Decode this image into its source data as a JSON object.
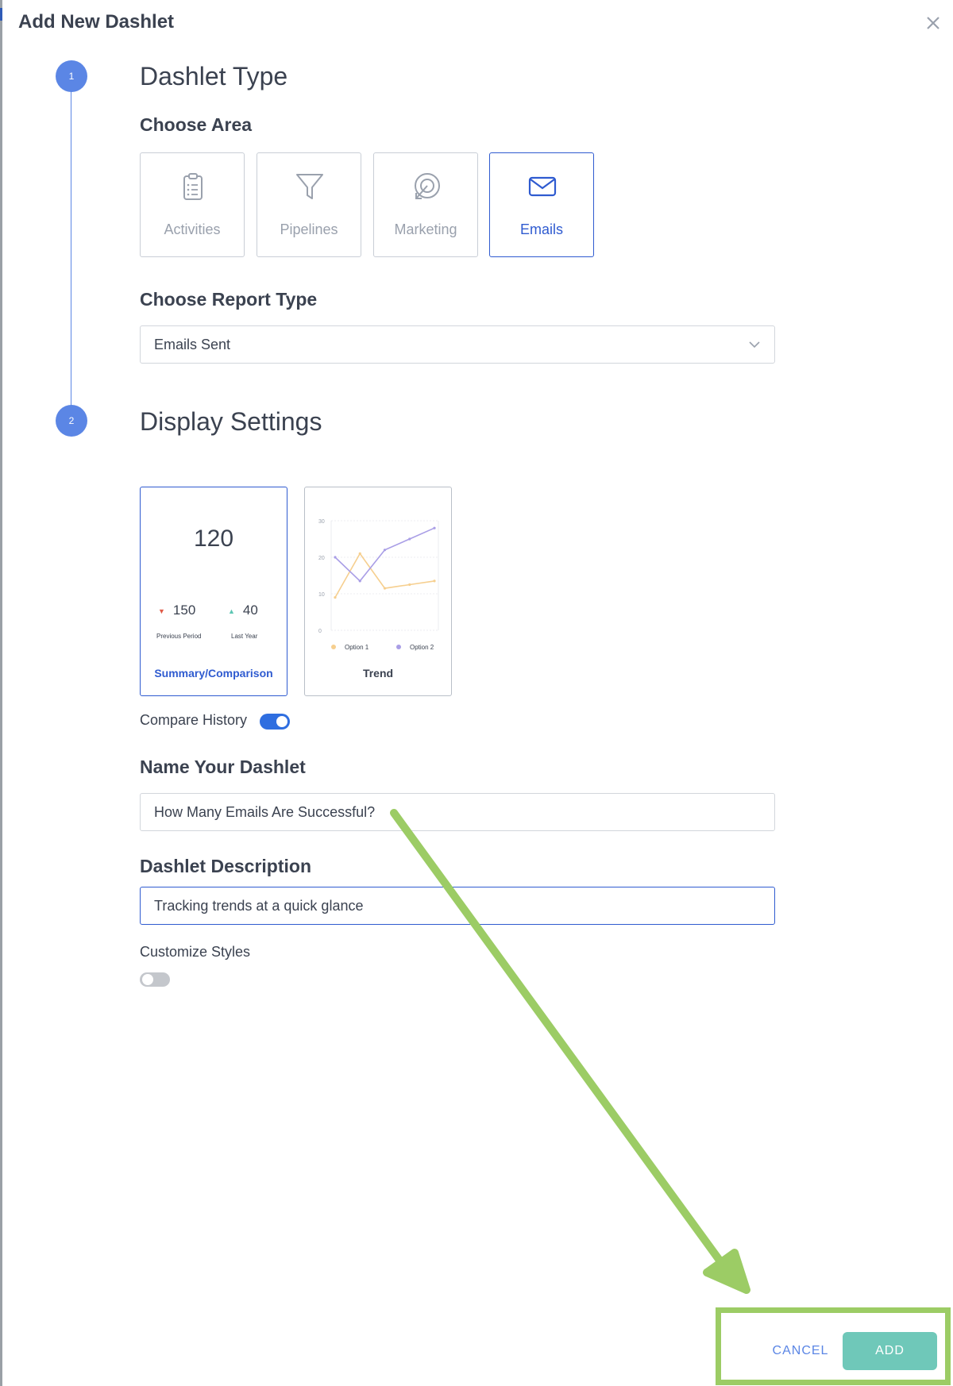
{
  "dialog": {
    "title": "Add New Dashlet"
  },
  "steps": [
    {
      "number": "1",
      "title": "Dashlet Type"
    },
    {
      "number": "2",
      "title": "Display Settings"
    }
  ],
  "choose_area": {
    "label": "Choose Area",
    "options": [
      {
        "label": "Activities",
        "icon": "clipboard-icon",
        "selected": false
      },
      {
        "label": "Pipelines",
        "icon": "funnel-icon",
        "selected": false
      },
      {
        "label": "Marketing",
        "icon": "target-icon",
        "selected": false
      },
      {
        "label": "Emails",
        "icon": "envelope-icon",
        "selected": true
      }
    ]
  },
  "report_type": {
    "label": "Choose Report Type",
    "value": "Emails Sent"
  },
  "display_options": {
    "summary": {
      "caption": "Summary/Comparison",
      "big_number": "120",
      "previous_value": "150",
      "previous_label": "Previous Period",
      "last_year_value": "40",
      "last_year_label": "Last Year",
      "selected": true
    },
    "trend": {
      "caption": "Trend",
      "selected": false,
      "chart_data": {
        "type": "line",
        "x": [
          1,
          2,
          3,
          4,
          5
        ],
        "series": [
          {
            "name": "Option 1",
            "values": [
              9,
              21,
              11.5,
              12.5,
              13.5
            ],
            "color": "#f6cf8f"
          },
          {
            "name": "Option 2",
            "values": [
              20,
              13.5,
              22,
              25,
              28
            ],
            "color": "#a99ee6"
          }
        ],
        "yticks": [
          "30",
          "20",
          "10",
          "0"
        ],
        "ylim": [
          0,
          30
        ],
        "grid": true,
        "legend": "bottom"
      }
    }
  },
  "compare_history": {
    "label": "Compare History",
    "enabled": true
  },
  "name": {
    "label": "Name Your Dashlet",
    "value": "How Many Emails Are Successful?"
  },
  "description": {
    "label": "Dashlet Description",
    "value": "Tracking trends at a quick glance"
  },
  "customize_styles": {
    "label": "Customize Styles",
    "enabled": false
  },
  "footer": {
    "cancel_label": "CANCEL",
    "add_label": "ADD"
  },
  "colors": {
    "accent": "#2f5bd0",
    "step": "#5b86e5",
    "add_button": "#6fc8b9",
    "annotation": "#9ccc65"
  }
}
